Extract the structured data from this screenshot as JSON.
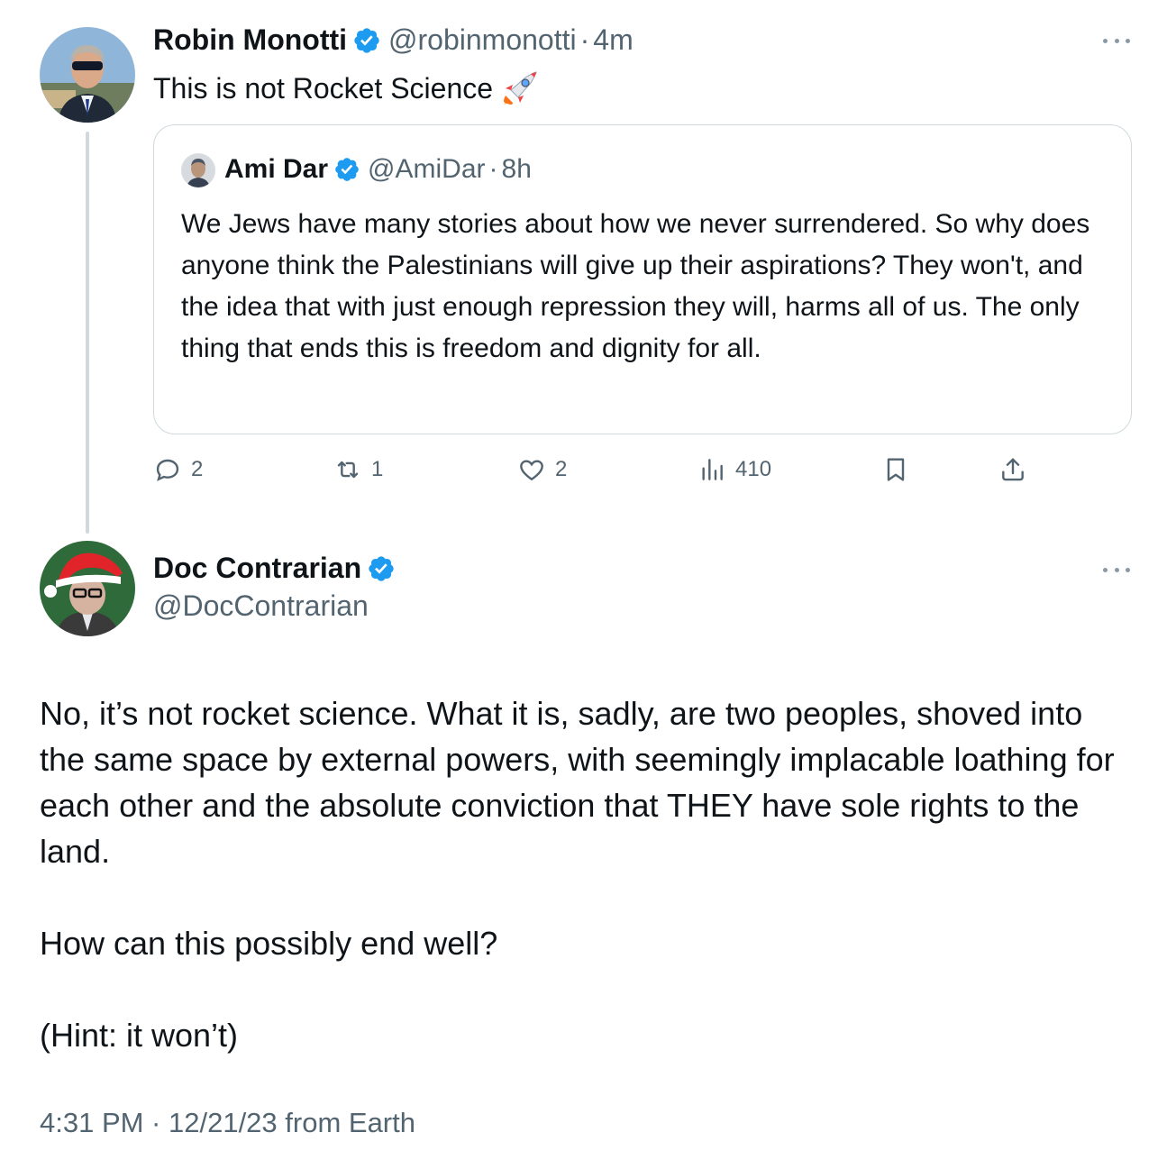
{
  "original_tweet": {
    "author": {
      "display_name": "Robin Monotti",
      "handle": "@robinmonotti",
      "verified": true,
      "avatar_icon": "man-in-sunglasses-avatar"
    },
    "separator": "·",
    "time": "4m",
    "text": "This is not Rocket Science",
    "emoji": "rocket-emoji",
    "quoted_tweet": {
      "author": {
        "display_name": "Ami Dar",
        "handle": "@AmiDar",
        "verified": true,
        "avatar_icon": "man-portrait-avatar"
      },
      "separator": "·",
      "time": "8h",
      "text": "We Jews have many stories about how we never surrendered. So why does anyone think the Palestinians will give up their aspirations? They won't, and the idea that with just enough repression they will, harms all of us. The only thing that ends this is freedom and dignity for all."
    },
    "actions": {
      "replies": "2",
      "retweets": "1",
      "likes": "2",
      "views": "410"
    }
  },
  "reply_tweet": {
    "author": {
      "display_name": "Doc Contrarian",
      "handle": "@DocContrarian",
      "verified": true,
      "avatar_icon": "santa-hat-man-avatar"
    },
    "paragraphs": [
      "No, it’s not rocket science. What it is, sadly, are two peoples, shoved into the same space by external powers, with seemingly implacable loathing for each other and the absolute conviction that THEY have sole rights to the land.",
      "How can this possibly end well?",
      "(Hint: it won’t)"
    ],
    "meta": "4:31 PM · 12/21/23 from Earth"
  },
  "colors": {
    "text_primary": "#0f1419",
    "text_secondary": "#536471",
    "verified_blue": "#1d9bf0",
    "border": "#cfd9de"
  }
}
